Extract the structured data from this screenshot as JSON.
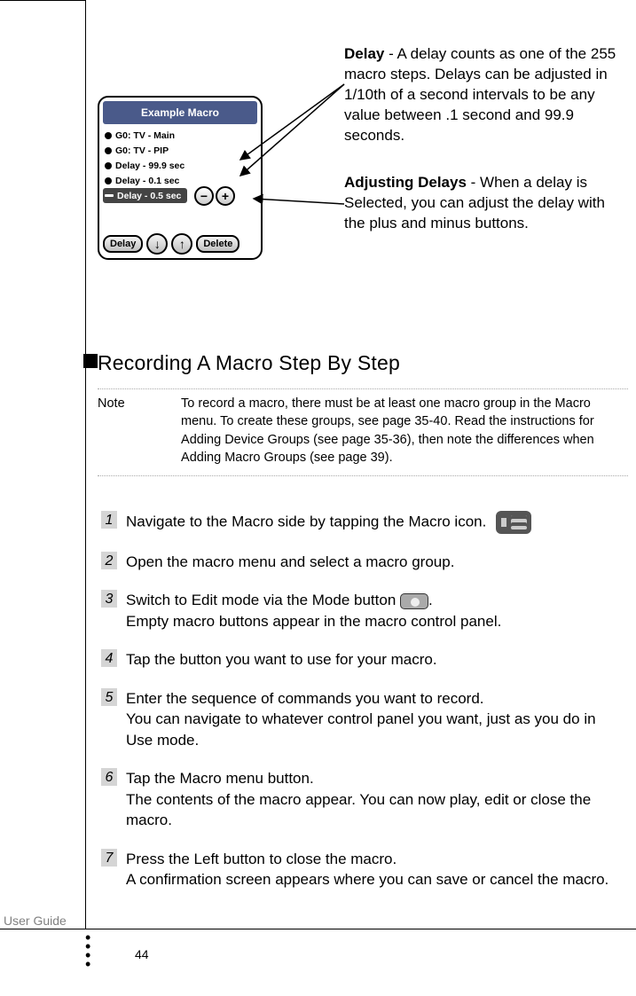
{
  "page_label": "User Guide",
  "page_number": "44",
  "mockup": {
    "title": "Example Macro",
    "rows": [
      "G0: TV - Main",
      "G0: TV - PIP",
      "Delay - 99.9 sec",
      "Delay - 0.1 sec",
      "Delay - 0.5 sec"
    ],
    "bottom": {
      "delay": "Delay",
      "delete": "Delete"
    }
  },
  "callouts": {
    "delay_lead": "Delay",
    "delay_text": " - A delay counts as one of the 255 macro steps. Delays can be adjusted in 1/10th of a second intervals to be any value between .1 second and 99.9 seconds.",
    "adjust_lead": "Adjusting Delays",
    "adjust_text": " - When a delay is Selected,  you can adjust the delay with the plus and minus buttons."
  },
  "heading": "Recording A Macro Step By Step",
  "note": {
    "label": "Note",
    "body": "To record a macro, there must be at least one macro group in the Macro menu. To create these groups, see page 35-40. Read the instructions for Adding Device Groups (see page 35-36), then note the differences when Adding Macro Groups (see page 39)."
  },
  "steps": [
    {
      "n": "1",
      "text": "Navigate to the Macro side by tapping the Macro icon."
    },
    {
      "n": "2",
      "text": "Open the macro menu and select a macro group."
    },
    {
      "n": "3",
      "text_pre": "Switch to Edit mode via the Mode button ",
      "text_post": ".\nEmpty macro buttons appear in the macro control panel."
    },
    {
      "n": "4",
      "text": "Tap the button you want to use for your macro."
    },
    {
      "n": "5",
      "text": "Enter the sequence of commands you want to record.\nYou can navigate to whatever control panel you want, just as you do in Use mode."
    },
    {
      "n": "6",
      "text": "Tap the Macro menu button.\nThe contents of the macro appear. You can now play, edit or close the macro."
    },
    {
      "n": "7",
      "text": "Press the Left button to close the macro.\nA confirmation screen appears where you can save or cancel the macro."
    }
  ]
}
